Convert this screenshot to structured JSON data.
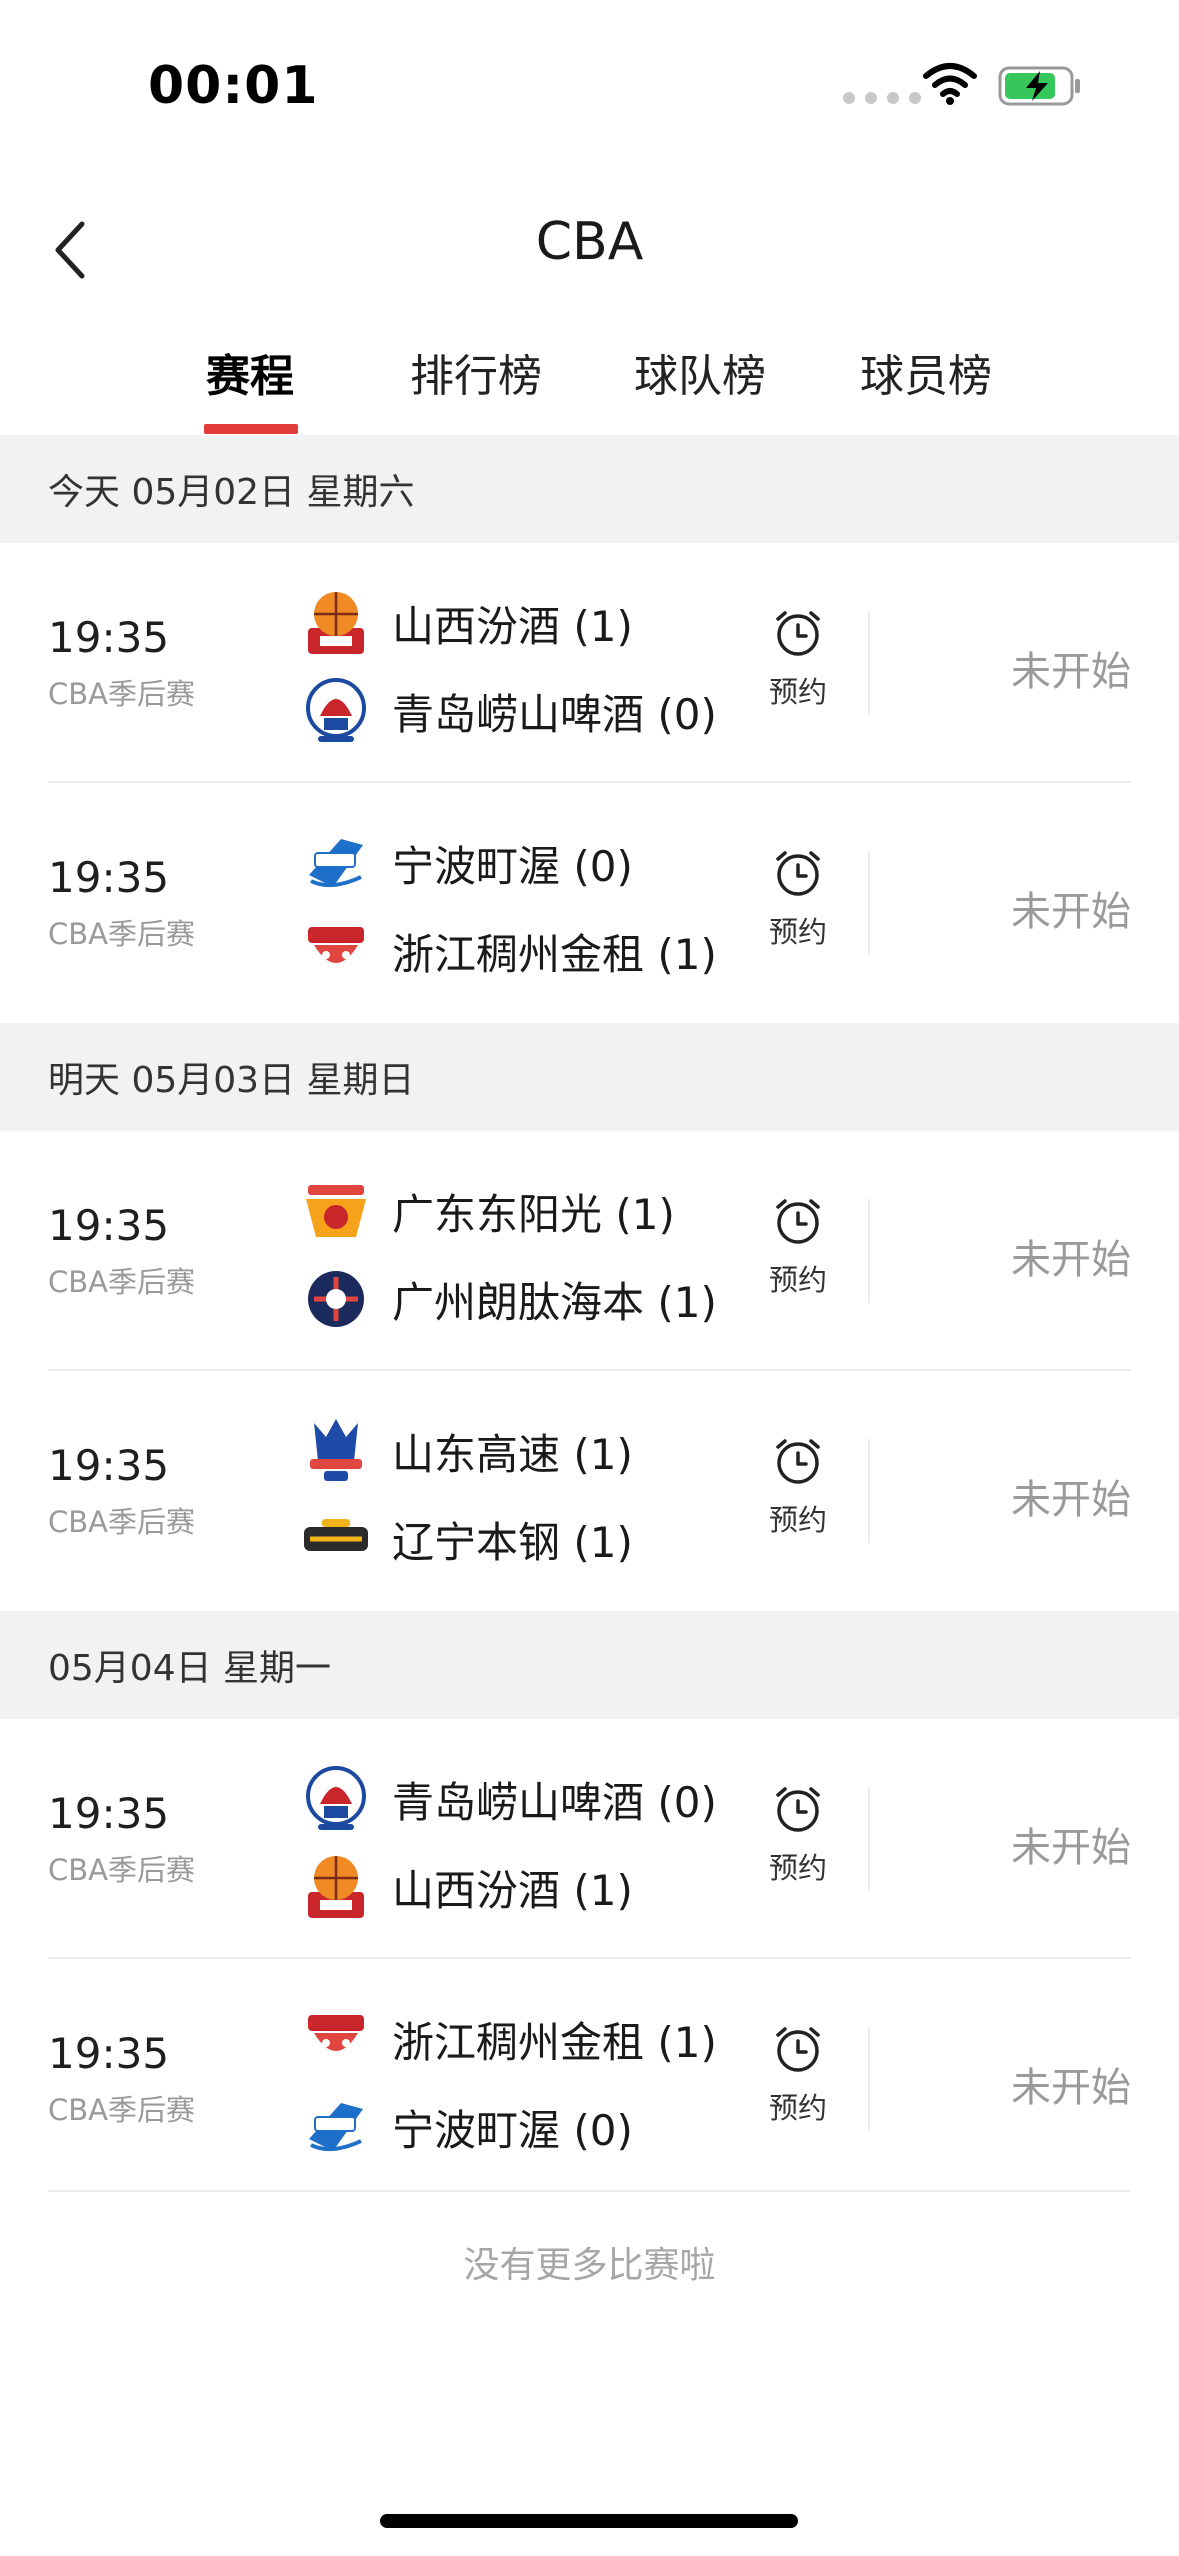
{
  "status_bar": {
    "time": "00:01"
  },
  "nav": {
    "title": "CBA"
  },
  "tabs": [
    {
      "label": "赛程",
      "active": true
    },
    {
      "label": "排行榜",
      "active": false
    },
    {
      "label": "球队榜",
      "active": false
    },
    {
      "label": "球员榜",
      "active": false
    }
  ],
  "days": [
    {
      "header": "今天 05月02日 星期六",
      "matches": [
        {
          "time": "19:35",
          "league": "CBA季后赛",
          "home": "山西汾酒 (1)",
          "away": "青岛崂山啤酒 (0)",
          "remind": "预约",
          "status": "未开始"
        },
        {
          "time": "19:35",
          "league": "CBA季后赛",
          "home": "宁波町渥 (0)",
          "away": "浙江稠州金租 (1)",
          "remind": "预约",
          "status": "未开始"
        }
      ]
    },
    {
      "header": "明天 05月03日 星期日",
      "matches": [
        {
          "time": "19:35",
          "league": "CBA季后赛",
          "home": "广东东阳光 (1)",
          "away": "广州朗肽海本 (1)",
          "remind": "预约",
          "status": "未开始"
        },
        {
          "time": "19:35",
          "league": "CBA季后赛",
          "home": "山东高速 (1)",
          "away": "辽宁本钢 (1)",
          "remind": "预约",
          "status": "未开始"
        }
      ]
    },
    {
      "header": "05月04日 星期一",
      "matches": [
        {
          "time": "19:35",
          "league": "CBA季后赛",
          "home": "青岛崂山啤酒 (0)",
          "away": "山西汾酒 (1)",
          "remind": "预约",
          "status": "未开始"
        },
        {
          "time": "19:35",
          "league": "CBA季后赛",
          "home": "浙江稠州金租 (1)",
          "away": "宁波町渥 (0)",
          "remind": "预约",
          "status": "未开始"
        }
      ]
    }
  ],
  "footer": {
    "no_more": "没有更多比赛啦"
  },
  "colors": {
    "accent": "#e03a3a",
    "muted": "#9a9a9a",
    "section_bg": "#f1f2f4",
    "battery": "#35c759"
  },
  "team_logos": {
    "山西": "shanxi-logo",
    "青岛": "qingdao-logo",
    "宁波": "ningbo-logo",
    "浙江": "zhejiang-logo",
    "广东": "guangdong-logo",
    "广州": "guangzhou-logo",
    "山东": "shandong-logo",
    "辽宁": "liaoning-logo"
  }
}
